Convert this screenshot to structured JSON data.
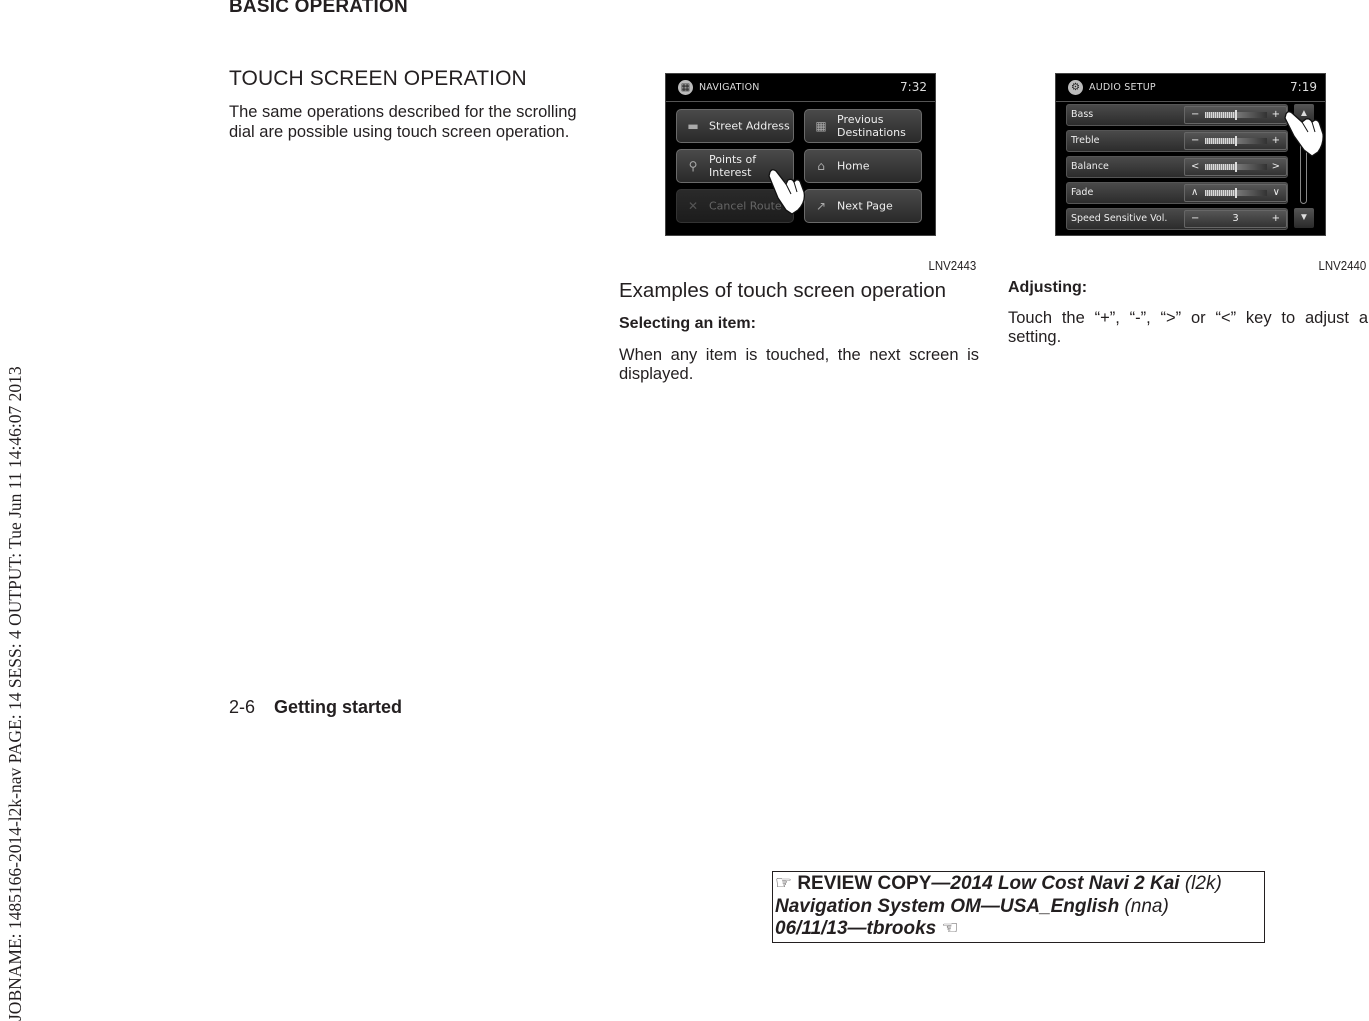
{
  "jobname": "JOBNAME: 1485166-2014-l2k-nav  PAGE: 14  SESS: 4  OUTPUT: Tue Jun 11 14:46:07 2013",
  "section_header": "BASIC OPERATION",
  "touch_section": {
    "heading": "TOUCH SCREEN OPERATION",
    "intro": "The same operations described for the scrolling dial are possible using touch screen operation."
  },
  "figure_nav": {
    "title": "NAVIGATION",
    "title_icon": "checkered-flag-icon",
    "time": "7:32",
    "buttons": [
      {
        "label": "Street Address",
        "icon": "street-address-icon",
        "enabled": true
      },
      {
        "label": "Previous Destinations",
        "icon": "previous-destinations-icon",
        "enabled": true
      },
      {
        "label": "Points of Interest",
        "icon": "poi-pin-icon",
        "enabled": true
      },
      {
        "label": "Home",
        "icon": "home-icon",
        "enabled": true
      },
      {
        "label": "Cancel Route",
        "icon": "cancel-route-icon",
        "enabled": false
      },
      {
        "label": "Next Page",
        "icon": "next-page-icon",
        "enabled": true
      }
    ],
    "caption": "LNV2443"
  },
  "figure_audio": {
    "title": "AUDIO SETUP",
    "title_icon": "gear-icon",
    "time": "7:19",
    "rows": [
      {
        "label": "Bass",
        "left_key": "−",
        "right_key": "+",
        "level": 0.5
      },
      {
        "label": "Treble",
        "left_key": "−",
        "right_key": "+",
        "level": 0.5
      },
      {
        "label": "Balance",
        "left_key": "<",
        "right_key": ">",
        "level": 0.5
      },
      {
        "label": "Fade",
        "left_key": "∧",
        "right_key": "∨",
        "level": 0.5
      },
      {
        "label": "Speed Sensitive Vol.",
        "left_key": "−",
        "right_key": "+",
        "value": "3"
      }
    ],
    "scroll_up": "▲",
    "scroll_down": "▼",
    "caption": "LNV2440"
  },
  "examples": {
    "heading": "Examples of touch screen operation",
    "selecting_title": "Selecting an item:",
    "selecting_text": "When any item is touched, the next screen is displayed.",
    "adjusting_title": "Adjusting:",
    "adjusting_text": "Touch the “+”, “-”, “>” or “<” key to adjust a setting."
  },
  "footer": {
    "page_number": "2-6",
    "page_title": "Getting started"
  },
  "review_box": {
    "line1_bold": "REVIEW COPY",
    "line1_italic": "—2014 Low Cost Navi 2 Kai",
    "line1_code": "(l2k)",
    "line2_italic": "Navigation System OM—USA_English",
    "line2_code": "(nna)",
    "line3_italic": "06/11/13—tbrooks",
    "pointer_right": "☞",
    "pointer_left": "☜"
  }
}
